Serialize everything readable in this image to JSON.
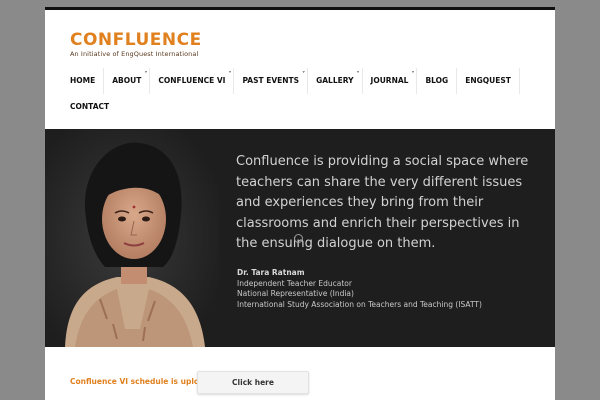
{
  "site": {
    "logo_text": "CONFLUENCE",
    "tagline": "An Initiative of EngQuest International",
    "accent_color": "#e0801e"
  },
  "nav": {
    "items": [
      {
        "label": "HOME",
        "has_submenu": false
      },
      {
        "label": "ABOUT",
        "has_submenu": true
      },
      {
        "label": "CONFLUENCE VI",
        "has_submenu": true
      },
      {
        "label": "PAST EVENTS",
        "has_submenu": true
      },
      {
        "label": "GALLERY",
        "has_submenu": true
      },
      {
        "label": "JOURNAL",
        "has_submenu": true
      },
      {
        "label": "BLOG",
        "has_submenu": false
      },
      {
        "label": "ENGQUEST",
        "has_submenu": false
      },
      {
        "label": "CONTACT",
        "has_submenu": false
      }
    ]
  },
  "hero": {
    "quote": "Confluence is providing a social space where teachers can share the very different issues and experiences they bring from their classrooms and enrich their perspectives in the ensuing dialogue on them.",
    "author_name": "Dr. Tara Ratnam",
    "author_lines": [
      "Independent Teacher Educator",
      "National Representative (India)",
      "International Study Association on Teachers and Teaching (ISATT)"
    ]
  },
  "announcement": {
    "text": "Confluence VI schedule is uploaded",
    "button_label": "Click here"
  }
}
